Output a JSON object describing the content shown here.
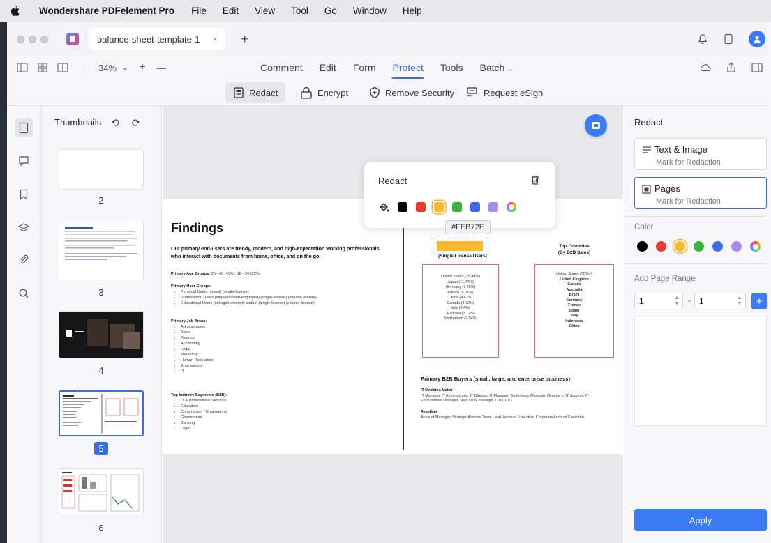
{
  "menubar": {
    "app_name": "Wondershare PDFelement Pro",
    "items": [
      "File",
      "Edit",
      "View",
      "Tool",
      "Go",
      "Window",
      "Help"
    ]
  },
  "tabbar": {
    "tab_title": "balance-sheet-template-1",
    "close_glyph": "×",
    "new_tab_glyph": "+"
  },
  "toolbar": {
    "zoom": "34%",
    "zoom_in": "+",
    "zoom_out": "—",
    "tabs": [
      "Comment",
      "Edit",
      "Form",
      "Protect",
      "Tools",
      "Batch"
    ],
    "active_tab": "Protect",
    "batch_caret": "⌄"
  },
  "subtoolbar": {
    "redact": "Redact",
    "encrypt": "Encrypt",
    "remove_security": "Remove Security",
    "request_esign": "Request eSign"
  },
  "thumbnails": {
    "header": "Thumbnails",
    "pages": [
      "2",
      "3",
      "4",
      "5",
      "6"
    ],
    "selected": "5"
  },
  "popover": {
    "title": "Redact",
    "colors": [
      "#000000",
      "#E8392B",
      "#FEB72E",
      "#3DB33D",
      "#3E6CE0",
      "#A98BF0"
    ],
    "tooltip": "#FEB72E",
    "selected_color": "#FEB72E"
  },
  "document": {
    "title": "Findings",
    "intro": "Our primary end-users are trendy, modern, and high-expectation working professionals who interact with documents from home, office, and on the go.",
    "age_label": "Primary Age Groups:",
    "age_value": "25 - 40 (40%), 18 - 24 (25%)",
    "user_groups_label": "Primary User Groups:",
    "user_groups": [
      "Personal Users (mixed) (single-license)",
      "Professional Users (employed/self-employed) (single-license) (volume-license)",
      "Educational Users (college/university status) (single-license) (volume-license)"
    ],
    "job_areas_label": "Primary Job Areas:",
    "job_areas": [
      "Administration",
      "Sales",
      "Finance",
      "Accounting",
      "Legal",
      "Marketing",
      "Human Resources",
      "Engineering",
      "IT"
    ],
    "segments_label": "Top Industry Segments (B2B):",
    "segments": [
      "IT & Professional Services",
      "Education",
      "Construction / Engineering",
      "Government",
      "Banking",
      "Legal"
    ],
    "single_license_head": "(Single License Users)",
    "single_license_rows": [
      "United States (25.49%)",
      "Japan (11.74%)",
      "Germany (7.26%)",
      "France (6.07%)",
      "China (4.47%)",
      "Canada (3.72%)",
      "Italy (3.4%)",
      "Australia (3.12%)",
      "Switzerland (2.54%)"
    ],
    "top_countries_head_1": "Top Countries",
    "top_countries_head_2": "(By B2B Sales)",
    "top_countries_rows": [
      "United States (50%+)",
      "United Kingdom",
      "Canada",
      "Australia",
      "Brazil",
      "Germany",
      "France",
      "Spain",
      "Italy",
      "Indonesia",
      "China"
    ],
    "b2b_title": "Primary B2B Buyers (small, large, and enterprise business)",
    "it_label": "IT Decision Maker",
    "it_text": "IT Manager, IT Administrator, IT Director, IT Manager, Technology Manager, Director of IT Support, IT Procurement Manager, Help Desk Manager, CTO, CIO",
    "resellers_label": "Resellers",
    "resellers_text": "Account Manager, Strategic Account Team Lead, Account Executive, Corporate Account Executive"
  },
  "rightpanel": {
    "title": "Redact",
    "option_text_image": "Text & Image",
    "option_text_image_sub": "Mark for Redaction",
    "option_pages": "Pages",
    "option_pages_sub": "Mark for Redaction",
    "color_label": "Color",
    "colors": [
      "#000000",
      "#E8392B",
      "#FEB72E",
      "#3DB33D",
      "#3E6CE0",
      "#A98BF0"
    ],
    "range_label": "Add Page Range",
    "range_from": "1",
    "range_dash": "-",
    "range_to": "1",
    "add_glyph": "+",
    "apply": "Apply"
  }
}
